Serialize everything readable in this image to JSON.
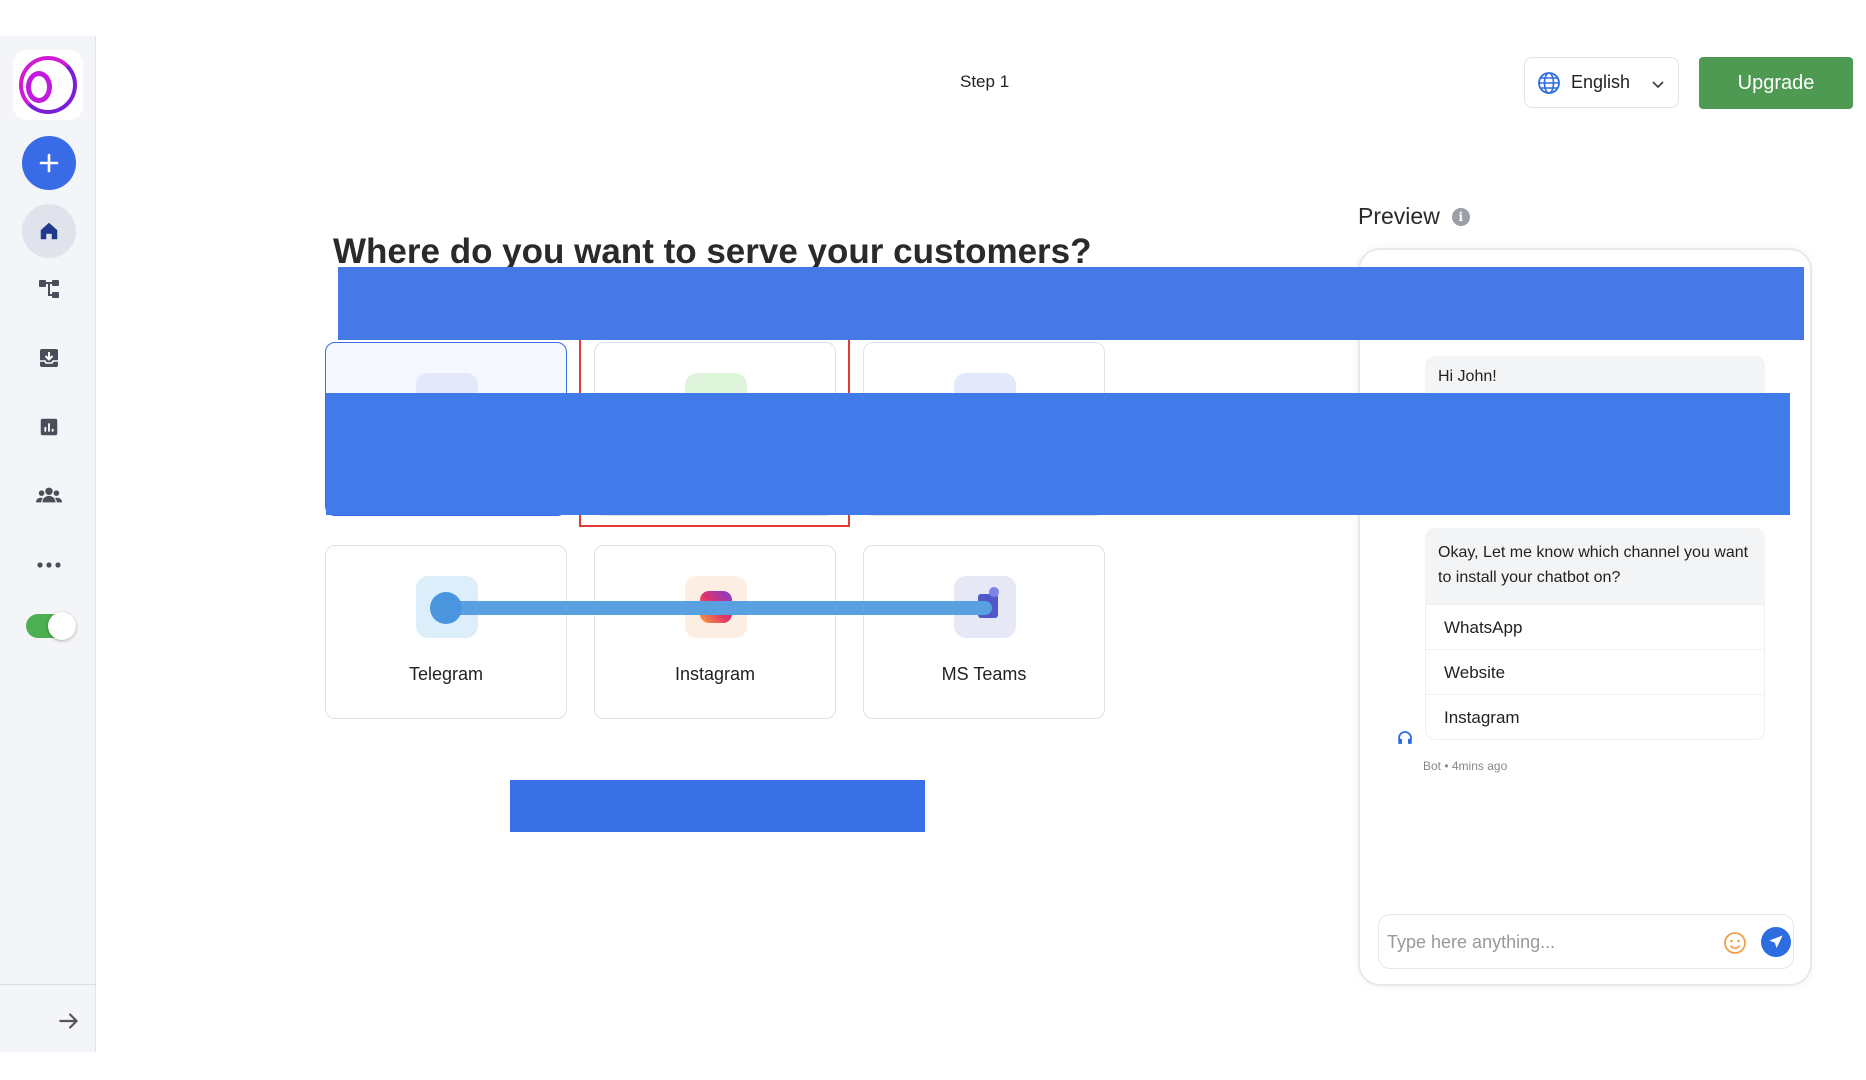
{
  "header": {
    "step": "Step 1",
    "language": "English",
    "upgrade_label": "Upgrade"
  },
  "main": {
    "title": "Where do you want to serve your customers?",
    "channels": [
      {
        "label": "",
        "icon": "website-icon",
        "selected": true
      },
      {
        "label": "",
        "icon": "whatsapp-icon",
        "selected": false
      },
      {
        "label": "",
        "icon": "messenger-icon",
        "selected": false
      },
      {
        "label": "Telegram",
        "icon": "telegram-icon",
        "selected": false
      },
      {
        "label": "Instagram",
        "icon": "instagram-icon",
        "selected": false
      },
      {
        "label": "MS Teams",
        "icon": "ms-teams-icon",
        "selected": false
      }
    ]
  },
  "preview": {
    "title": "Preview",
    "greeting": "Hi John!",
    "question": "Okay, Let me know which channel you want to install your chatbot on?",
    "options": [
      "WhatsApp",
      "Website",
      "Instagram"
    ],
    "bot_meta": "Bot • 4mins ago",
    "input_placeholder": "Type here anything..."
  },
  "colors": {
    "primary": "#3a6be6",
    "upgrade": "#4f9a53",
    "toggle_on": "#4caf50",
    "redaction": "#4279ea"
  }
}
